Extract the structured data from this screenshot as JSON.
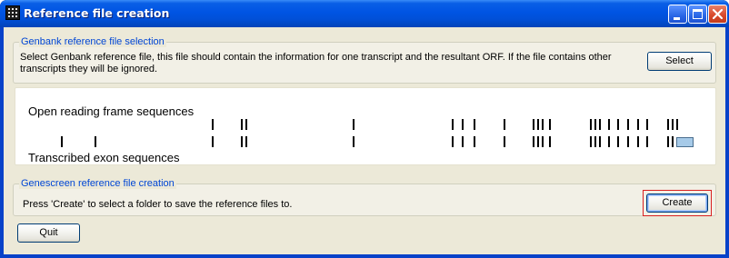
{
  "window": {
    "title": "Reference file creation"
  },
  "genbank_group": {
    "legend": "Genbank reference file selection",
    "description": "Select Genbank  reference file, this file should contain the information for one transcript and the resultant ORF. If the file contains other transcripts they will be ignored.",
    "select_label": "Select"
  },
  "sequence_view": {
    "orf_label": "Open reading frame sequences",
    "exon_label": "Transcribed exon sequences",
    "orf_tracks": [
      232,
      264,
      269,
      387,
      496,
      507,
      520,
      553,
      585,
      590,
      595,
      603,
      648,
      653,
      658,
      668,
      678,
      689,
      700,
      710,
      733,
      738,
      743
    ],
    "exon_tracks": [
      66,
      103,
      232,
      264,
      269,
      387,
      496,
      507,
      520,
      553,
      585,
      590,
      595,
      603,
      648,
      653,
      658,
      668,
      678,
      689,
      700,
      710,
      733,
      738
    ],
    "selected_region": [
      743,
      762
    ],
    "colors": {
      "marker": "#000000",
      "selection_fill": "#a6cae8"
    }
  },
  "genescreen_group": {
    "legend": "Genescreen reference file creation",
    "description": "Press 'Create' to select a folder to save the reference files to.",
    "create_label": "Create"
  },
  "footer": {
    "quit_label": "Quit"
  },
  "colors": {
    "titlebar": "#0054e3",
    "legend_text": "#0046d5",
    "client_background": "#ece9d8",
    "focus_ring": "#d92020"
  }
}
